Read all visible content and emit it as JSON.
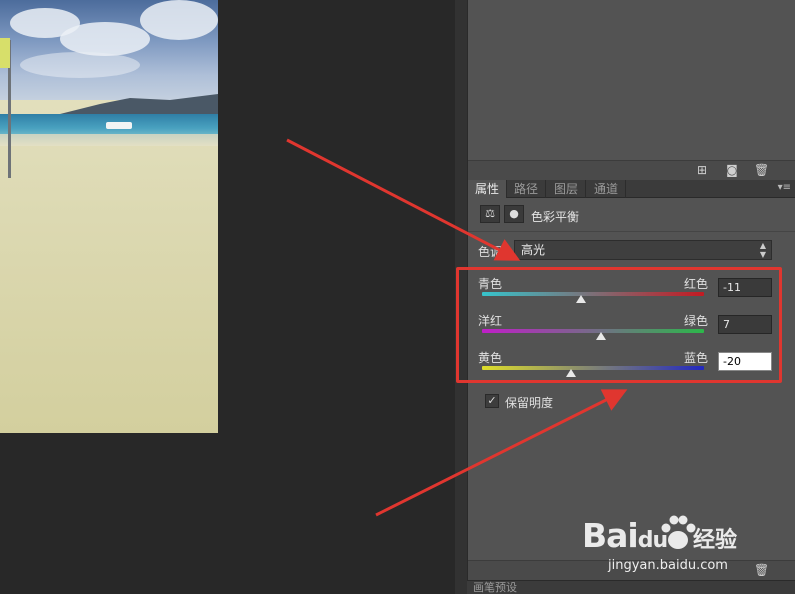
{
  "properties_panel": {
    "tabs": [
      "属性",
      "路径",
      "图层",
      "通道"
    ],
    "active_tab": "属性",
    "adjustment_title": "色彩平衡",
    "tone": {
      "label": "色调:",
      "selected": "高光"
    },
    "sliders": [
      {
        "left_label": "青色",
        "right_label": "红色",
        "value": "-11",
        "numeric_value": -11,
        "range": [
          -100,
          100
        ],
        "gradient": [
          "#36c4cc",
          "#c41a22"
        ]
      },
      {
        "left_label": "洋红",
        "right_label": "绿色",
        "value": "7",
        "numeric_value": 7,
        "range": [
          -100,
          100
        ],
        "gradient": [
          "#c01ec8",
          "#2cb84a"
        ]
      },
      {
        "left_label": "黄色",
        "right_label": "蓝色",
        "value": "-20",
        "numeric_value": -20,
        "range": [
          -100,
          100
        ],
        "gradient": [
          "#dede2a",
          "#2228c0"
        ]
      }
    ],
    "preserve_luminosity": {
      "label": "保留明度",
      "checked": true
    }
  },
  "brush_presets_tab": "画笔预设",
  "watermark": {
    "brand": "Bai",
    "brand_suffix": "du",
    "product": "经验",
    "url": "jingyan.baidu.com"
  },
  "colors": {
    "highlight": "#e0362f",
    "arrow": "#e0362f",
    "panel_bg": "#535353",
    "workspace_bg": "#282828"
  }
}
